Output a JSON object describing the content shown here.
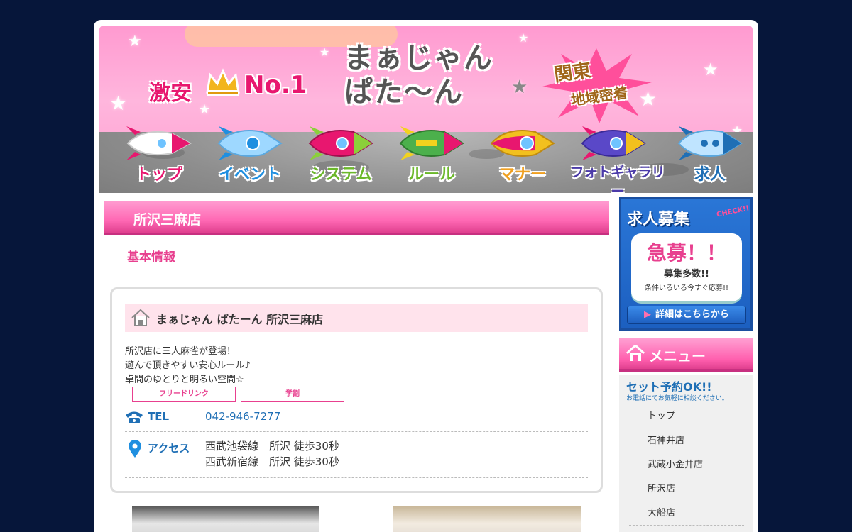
{
  "banner": {
    "logo_text_line1": "まぁじゃん",
    "logo_text_line2": "ぱた～ん",
    "cheap_text": "激安",
    "no1_text": "No.1",
    "kanto_line1": "関東",
    "kanto_line2": "地域密着"
  },
  "nav": {
    "items": [
      {
        "label": "トップ",
        "color": "#e8176f"
      },
      {
        "label": "イベント",
        "color": "#1f8fe0"
      },
      {
        "label": "システム",
        "color": "#6bb82a"
      },
      {
        "label": "ルール",
        "color": "#6bb82a"
      },
      {
        "label": "マナー",
        "color": "#f0a020"
      },
      {
        "label": "フォトギャラリー",
        "color": "#4a3aa8"
      },
      {
        "label": "求人",
        "color": "#1f6fb5"
      }
    ]
  },
  "main": {
    "section_title": "所沢三麻店",
    "sub_heading": "基本情報",
    "shop_name": "まぁじゃん ぱたーん 所沢三麻店",
    "description": [
      "所沢店に三人麻雀が登場！",
      "遊んで頂きやすい安心ルール♪",
      "卓間のゆとりと明るい空間☆"
    ],
    "tags": [
      "フリードリンク",
      "学割"
    ],
    "tel_label": "TEL",
    "tel_value": "042-946-7277",
    "access_label": "アクセス",
    "access_lines": [
      "西武池袋線　所沢 徒歩30秒",
      "西武新宿線　所沢 徒歩30秒"
    ]
  },
  "sidebar": {
    "recruit": {
      "title": "求人募集",
      "check": "CHECK!!",
      "big": "急募！！",
      "mid": "募集多数!!",
      "small": "条件いろいろ今すぐ応募!!",
      "button": "詳細はこちらから"
    },
    "menu_title": "メニュー",
    "set_ok": "セット予約OK!!",
    "set_sub": "お電話にてお気軽に相談ください。",
    "menu_items": [
      "トップ",
      "石神井店",
      "武蔵小金井店",
      "所沢店",
      "大船店"
    ]
  },
  "colors": {
    "accent_pink": "#e8408f",
    "link_blue": "#1f6fb5",
    "background_navy": "#06163a"
  }
}
